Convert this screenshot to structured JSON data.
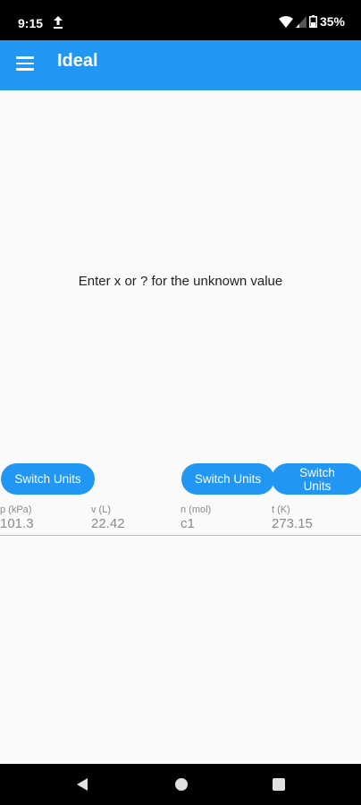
{
  "status_bar": {
    "time": "9:15",
    "battery": "35%"
  },
  "app_bar": {
    "title": "Ideal"
  },
  "hint": "Enter x or ? for the unknown value",
  "buttons": {
    "switch_p": "Switch Units",
    "switch_n": "Switch Units",
    "switch_t": "Switch Units"
  },
  "fields": [
    {
      "label": "p (kPa)",
      "value": "101.3"
    },
    {
      "label": "v (L)",
      "value": "22.42"
    },
    {
      "label": "n (mol)",
      "value": "c1"
    },
    {
      "label": "t (K)",
      "value": "273.15"
    }
  ],
  "colors": {
    "primary": "#2196f3",
    "background": "#fafafa",
    "field_text": "#8a8a8a"
  }
}
